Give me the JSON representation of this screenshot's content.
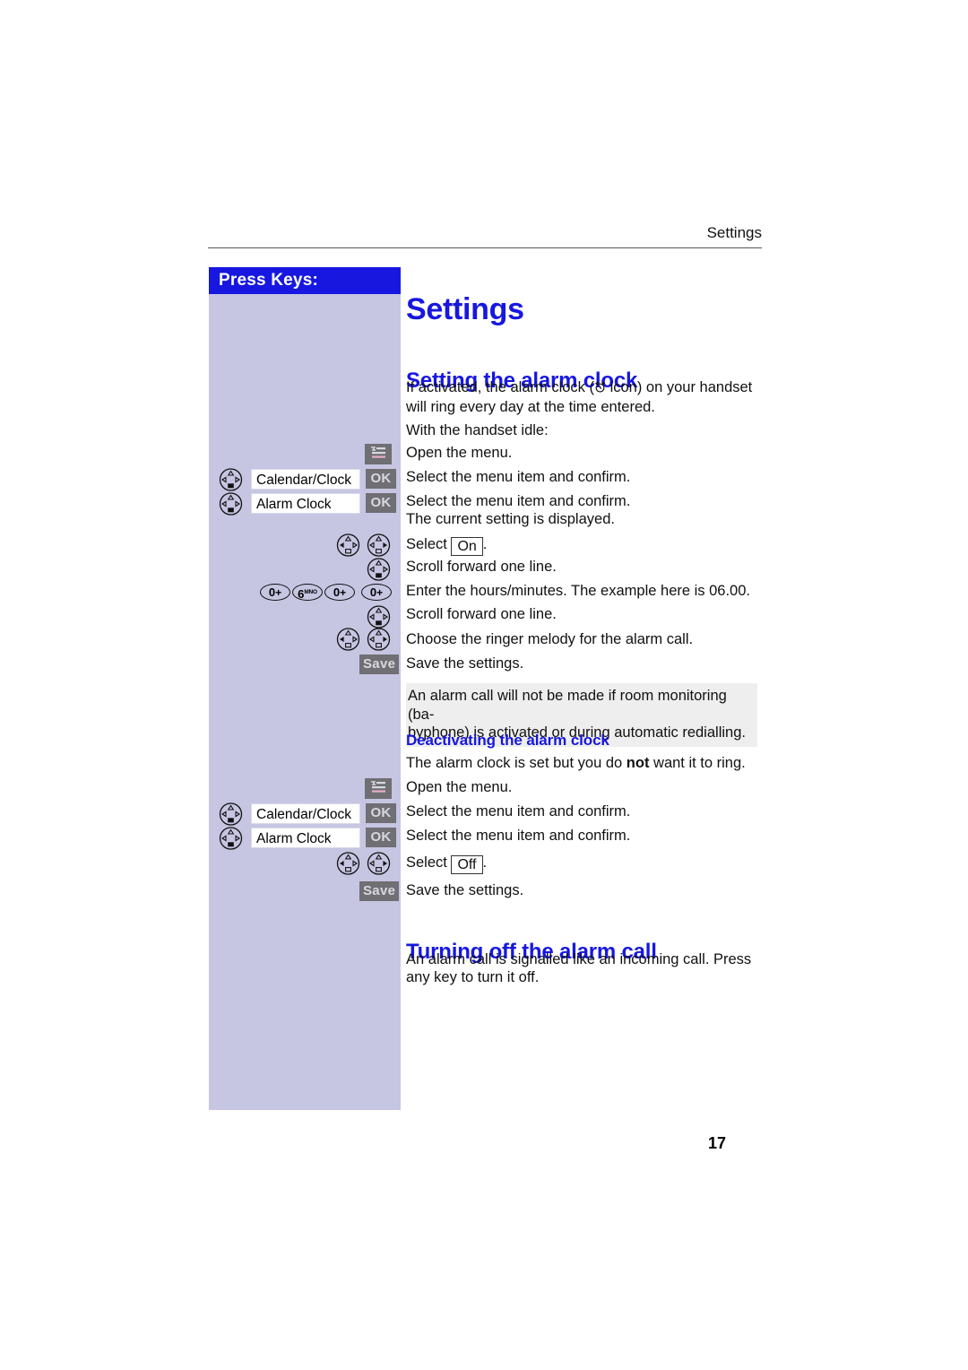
{
  "header": {
    "running_title": "Settings"
  },
  "sidebar": {
    "title": "Press Keys:"
  },
  "page_title": "Settings",
  "sections": [
    {
      "heading": "Setting the alarm clock",
      "intro_line1_before_icon": "If activated, the alarm clock (",
      "intro_icon": "alarm-clock-icon",
      "intro_line1_after_icon": " icon) on your handset",
      "intro_line2": "will ring every day at the time entered.",
      "idle_line": "With the handset idle:"
    },
    {
      "heading": "Deactivating the alarm clock",
      "lead_before_bold": "The alarm clock is set but you do ",
      "lead_bold": "not",
      "lead_after_bold": " want it to ring."
    },
    {
      "heading": "Turning off the alarm call",
      "body_line1": "An alarm call is signalled like an incoming call. Press",
      "body_line2": "any key to turn it off."
    }
  ],
  "steps_set": [
    {
      "keys": [
        {
          "type": "menu-button",
          "label": "menu-icon"
        }
      ],
      "desc": "Open the menu."
    },
    {
      "keys": [
        {
          "type": "nav-updown",
          "label": "nav-key"
        },
        {
          "type": "field",
          "label": "Calendar/Clock"
        },
        {
          "type": "gray-button",
          "label": "OK"
        }
      ],
      "desc": "Select the menu item and confirm."
    },
    {
      "keys": [
        {
          "type": "nav-updown",
          "label": "nav-key"
        },
        {
          "type": "field",
          "label": "Alarm Clock"
        },
        {
          "type": "gray-button",
          "label": "OK"
        }
      ],
      "desc": "Select the menu item and confirm.",
      "desc2": "The current setting is displayed."
    },
    {
      "keys": [
        {
          "type": "nav-left",
          "label": "nav-key-left"
        },
        {
          "type": "nav-right",
          "label": "nav-key-right"
        }
      ],
      "desc_before_box": "Select ",
      "desc_box": "On",
      "desc_after_box": "."
    },
    {
      "keys": [
        {
          "type": "nav-updown",
          "label": "nav-key"
        }
      ],
      "desc": "Scroll forward one line."
    },
    {
      "keys": [
        {
          "type": "numkey",
          "digit": "0",
          "sub": "+"
        },
        {
          "type": "numkey",
          "digit": "6",
          "sub": "MNO"
        },
        {
          "type": "numkey",
          "digit": "0",
          "sub": "+"
        },
        {
          "type": "numkey",
          "digit": "0",
          "sub": "+"
        }
      ],
      "desc": "Enter the hours/minutes. The example here is 06.00."
    },
    {
      "keys": [
        {
          "type": "nav-updown",
          "label": "nav-key"
        }
      ],
      "desc": "Scroll forward one line."
    },
    {
      "keys": [
        {
          "type": "nav-left",
          "label": "nav-key-left"
        },
        {
          "type": "nav-right",
          "label": "nav-key-right"
        }
      ],
      "desc": "Choose the ringer melody for the alarm call."
    },
    {
      "keys": [
        {
          "type": "gray-button",
          "label": "Save"
        }
      ],
      "desc": "Save the settings."
    }
  ],
  "note": {
    "line1": "An alarm call will not be made if room monitoring (ba-",
    "line2": "byphone) is activated or during automatic redialling."
  },
  "steps_deactivate": [
    {
      "keys": [
        {
          "type": "menu-button",
          "label": "menu-icon"
        }
      ],
      "desc": "Open the menu."
    },
    {
      "keys": [
        {
          "type": "nav-updown",
          "label": "nav-key"
        },
        {
          "type": "field",
          "label": "Calendar/Clock"
        },
        {
          "type": "gray-button",
          "label": "OK"
        }
      ],
      "desc": "Select the menu item and confirm."
    },
    {
      "keys": [
        {
          "type": "nav-updown",
          "label": "nav-key"
        },
        {
          "type": "field",
          "label": "Alarm Clock"
        },
        {
          "type": "gray-button",
          "label": "OK"
        }
      ],
      "desc": "Select the menu item and confirm."
    },
    {
      "keys": [
        {
          "type": "nav-left",
          "label": "nav-key-left"
        },
        {
          "type": "nav-right",
          "label": "nav-key-right"
        }
      ],
      "desc_before_box": "Select ",
      "desc_box": "Off",
      "desc_after_box": "."
    },
    {
      "keys": [
        {
          "type": "gray-button",
          "label": "Save"
        }
      ],
      "desc": "Save the settings."
    }
  ],
  "labels": {
    "menu_icon_name": "menu-icon",
    "ok_label": "OK",
    "save_label": "Save",
    "calendar_clock": "Calendar/Clock",
    "alarm_clock": "Alarm Clock",
    "on_label": "On",
    "off_label": "Off"
  },
  "page_number": "17",
  "colors": {
    "accent_blue": "#1717e0",
    "sidebar_bg": "#c6c5e2",
    "button_gray": "#6f6f74",
    "note_bg": "#eeeeee"
  }
}
